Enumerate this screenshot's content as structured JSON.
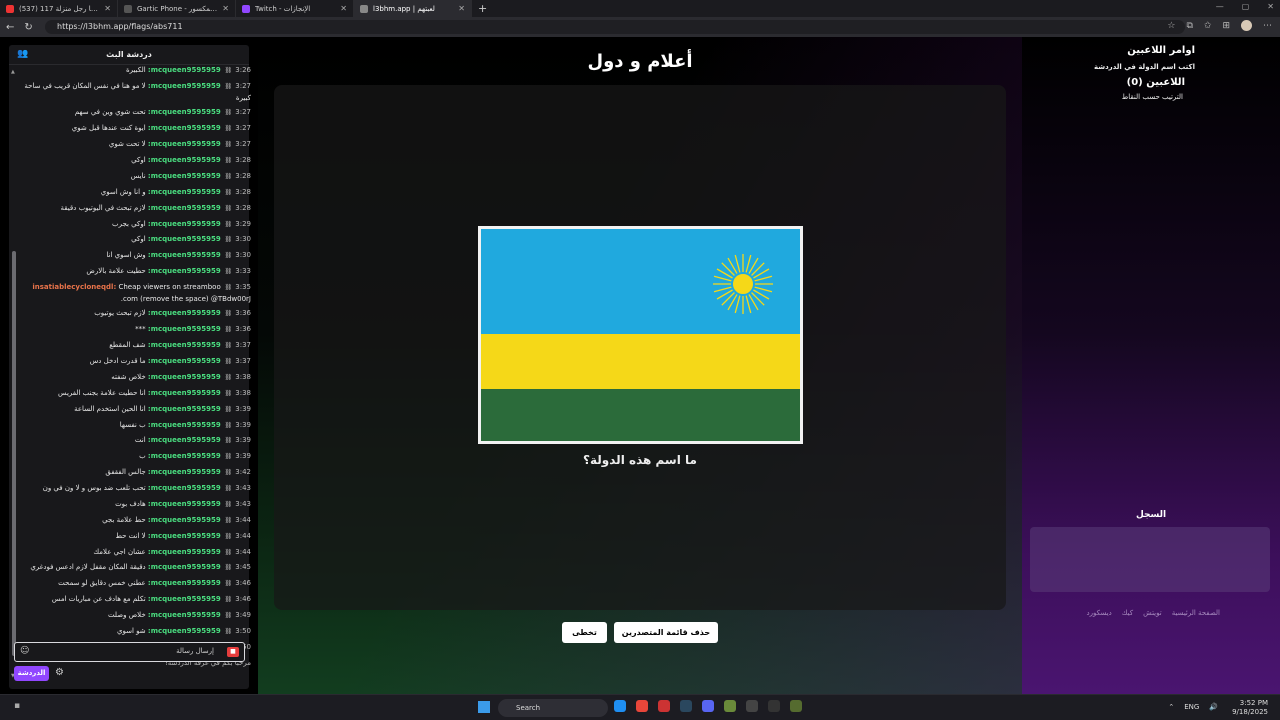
{
  "browser": {
    "tabs": [
      {
        "title": "(537) 117 يوم بني فيها رجل منزلة",
        "color": "#e33",
        "active": false
      },
      {
        "title": "Gartic Phone - لعبة الهاتف المكسور",
        "color": "#555",
        "active": false
      },
      {
        "title": "Twitch - الإنجازات",
        "color": "#9147ff",
        "active": false
      },
      {
        "title": "l3bhm.app | لعبتهم",
        "color": "#888",
        "active": true
      }
    ],
    "url": "https://l3bhm.app/flags/abs711"
  },
  "chat": {
    "header": "دردشة البث",
    "messages": [
      {
        "time": "3:26",
        "user": "mcqueen9595959:",
        "text": "الكبيرة",
        "user_color": "#4ade80"
      },
      {
        "time": "3:27",
        "user": "mcqueen9595959:",
        "text": "لا مو هنا في نفس المكان قريب في ساحة كبيرة",
        "user_color": "#4ade80"
      },
      {
        "time": "3:27",
        "user": "mcqueen9595959:",
        "text": "تحت شوي وين في سهم",
        "user_color": "#4ade80"
      },
      {
        "time": "3:27",
        "user": "mcqueen9595959:",
        "text": "ايوة كنت عندها قبل شوي",
        "user_color": "#4ade80"
      },
      {
        "time": "3:27",
        "user": "mcqueen9595959:",
        "text": "لا تحت شوي",
        "user_color": "#4ade80"
      },
      {
        "time": "3:28",
        "user": "mcqueen9595959:",
        "text": "اوكي",
        "user_color": "#4ade80"
      },
      {
        "time": "3:28",
        "user": "mcqueen9595959:",
        "text": "نايس",
        "user_color": "#4ade80"
      },
      {
        "time": "3:28",
        "user": "mcqueen9595959:",
        "text": "و انا وش اسوي",
        "user_color": "#4ade80"
      },
      {
        "time": "3:28",
        "user": "mcqueen9595959:",
        "text": "لازم تبحث في اليوتيوب دقيقة",
        "user_color": "#4ade80"
      },
      {
        "time": "3:29",
        "user": "mcqueen9595959:",
        "text": "اوكي بجرب",
        "user_color": "#4ade80"
      },
      {
        "time": "3:30",
        "user": "mcqueen9595959:",
        "text": "اوكي",
        "user_color": "#4ade80"
      },
      {
        "time": "3:30",
        "user": "mcqueen9595959:",
        "text": "وش اسوي انا",
        "user_color": "#4ade80"
      },
      {
        "time": "3:33",
        "user": "mcqueen9595959:",
        "text": "حطيت علامة بالارض",
        "user_color": "#4ade80"
      },
      {
        "time": "3:35",
        "user": "insatiablecycloneqdl:",
        "text": "Cheap viewers on streamboo .com (remove the space) @TBdw00rJ",
        "user_color": "#e8734a"
      },
      {
        "time": "3:36",
        "user": "mcqueen9595959:",
        "text": "لازم تبحث يوتيوب",
        "user_color": "#4ade80"
      },
      {
        "time": "3:36",
        "user": "mcqueen9595959:",
        "text": "***",
        "user_color": "#4ade80"
      },
      {
        "time": "3:37",
        "user": "mcqueen9595959:",
        "text": "شف المقطع",
        "user_color": "#4ade80"
      },
      {
        "time": "3:37",
        "user": "mcqueen9595959:",
        "text": "ما قدرت ادخل دس",
        "user_color": "#4ade80"
      },
      {
        "time": "3:38",
        "user": "mcqueen9595959:",
        "text": "خلاص شفته",
        "user_color": "#4ade80"
      },
      {
        "time": "3:38",
        "user": "mcqueen9595959:",
        "text": "انا حطيت علامة بجنب الفريس",
        "user_color": "#4ade80"
      },
      {
        "time": "3:39",
        "user": "mcqueen9595959:",
        "text": "انا الحين استخدم الساعة",
        "user_color": "#4ade80"
      },
      {
        "time": "3:39",
        "user": "mcqueen9595959:",
        "text": "ب نفسها",
        "user_color": "#4ade80"
      },
      {
        "time": "3:39",
        "user": "mcqueen9595959:",
        "text": "انت",
        "user_color": "#4ade80"
      },
      {
        "time": "3:39",
        "user": "mcqueen9595959:",
        "text": "ب",
        "user_color": "#4ade80"
      },
      {
        "time": "3:42",
        "user": "mcqueen9595959:",
        "text": "جالس الفقفق",
        "user_color": "#4ade80"
      },
      {
        "time": "3:43",
        "user": "mcqueen9595959:",
        "text": "تحب تلعب ضد بوس و لا ون في ون",
        "user_color": "#4ade80"
      },
      {
        "time": "3:43",
        "user": "mcqueen9595959:",
        "text": "هادف بوت",
        "user_color": "#4ade80"
      },
      {
        "time": "3:44",
        "user": "mcqueen9595959:",
        "text": "حط علامة بجي",
        "user_color": "#4ade80"
      },
      {
        "time": "3:44",
        "user": "mcqueen9595959:",
        "text": "لا انت حط",
        "user_color": "#4ade80"
      },
      {
        "time": "3:44",
        "user": "mcqueen9595959:",
        "text": "عشان اجي علامك",
        "user_color": "#4ade80"
      },
      {
        "time": "3:45",
        "user": "mcqueen9595959:",
        "text": "دقيقة المكان مقفل لازم ادعس فودغري",
        "user_color": "#4ade80"
      },
      {
        "time": "3:46",
        "user": "mcqueen9595959:",
        "text": "عطني خمس دقايق لو سمحت",
        "user_color": "#4ade80"
      },
      {
        "time": "3:46",
        "user": "mcqueen9595959:",
        "text": "تكلم مع هادف عن مباريات امس",
        "user_color": "#4ade80"
      },
      {
        "time": "3:49",
        "user": "mcqueen9595959:",
        "text": "خلاص وصلت",
        "user_color": "#4ade80"
      },
      {
        "time": "3:50",
        "user": "mcqueen9595959:",
        "text": "شو اسوي",
        "user_color": "#4ade80"
      },
      {
        "time": "3:50",
        "user": "mcqueen9595959:",
        "text": "اوكي",
        "user_color": "#4ade80"
      }
    ],
    "welcome": "مرحبا بكم في غرفة الدردشة!",
    "input_placeholder": "إرسال رسالة",
    "chat_button": "الدردشة"
  },
  "game": {
    "title": "أعلام و دول",
    "question": "ما اسم هذه الدولة؟",
    "flag_colors": [
      "#20a9de",
      "#f5d818",
      "#2b6b3a"
    ],
    "skip_button": "تخطى",
    "clear_leaderboard_button": "حذف قائمة المتصدرين"
  },
  "sidebar": {
    "commands_title": "اوامر اللاعبين",
    "commands_hint": "اكتب اسم الدولة في الدردشة",
    "players_title": "اللاعبين (0)",
    "sort_label": "الترتيب حسب النقاط",
    "log_title": "السجل",
    "footer_links": [
      "الصفحة الرئيسية",
      "تويتش",
      "كيك",
      "ديسكورد"
    ]
  },
  "taskbar": {
    "search_label": "Search",
    "lang": "ENG",
    "time": "3:52 PM",
    "date": "9/18/2025"
  }
}
